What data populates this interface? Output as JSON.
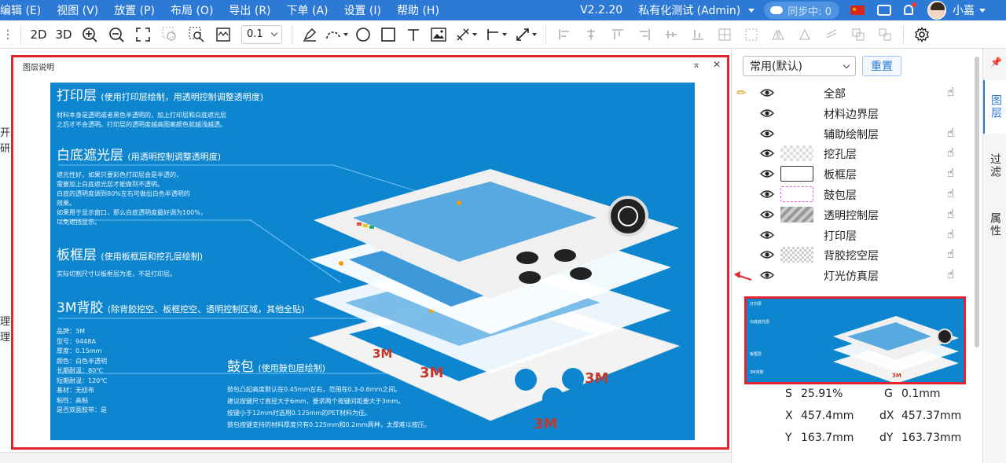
{
  "menu": {
    "items": [
      "编辑 (E)",
      "视图 (V)",
      "放置 (P)",
      "布局 (O)",
      "导出 (R)",
      "下单 (A)",
      "设置 (I)",
      "帮助 (H)"
    ],
    "version": "V2.2.20",
    "org": "私有化测试 (Admin)",
    "sync": "同步中: 0",
    "username": "小嘉"
  },
  "toolbar": {
    "btn_2d": "2D",
    "btn_3d": "3D",
    "zoom_value": "0.1"
  },
  "left_texts": [
    "开发",
    "研发",
    "",
    "",
    "",
    "",
    "",
    "",
    "",
    "",
    "",
    "",
    "",
    "理图",
    "理图"
  ],
  "dialog": {
    "title": "图层说明",
    "minimize_glyph": "⌅",
    "close_glyph": "✕",
    "sections": {
      "print": {
        "title": "打印层",
        "sub": "(使用打印层绘制，用透明控制调整透明度)",
        "body": [
          "材料本身是透明或者黑色半透明的，加上打印层和白底遮光层",
          "之后才不会透明。打印层的透明度越高图案颜色就越浅越透。"
        ]
      },
      "white": {
        "title": "白底遮光层",
        "sub": "(用透明控制调整透明度)",
        "body": [
          "遮光性好，如果只要彩色打印层会是半透的，",
          "需要加上白底遮光层才能做到不透明。",
          "白底的透明度调到80%左右可做出白色半透明的",
          "效果。",
          "如果用于显示窗口，那么白底透明度最好调为100%，",
          "以免遮挡显示。"
        ]
      },
      "frame": {
        "title": "板框层",
        "sub": "(使用板框层和挖孔层绘制)",
        "body": [
          "实际切割尺寸以板框层为准，不是打印层。"
        ]
      },
      "adhesive": {
        "title": "3M背胶",
        "sub": "(除背胶挖空、板框挖空、透明控制区域，其他全贴)",
        "body": [
          "品牌：3M",
          "型号：9448A",
          "厚度：0.15mm",
          "颜色：白色半透明",
          "长期耐温：80℃",
          "短期耐温：120℃",
          "基材：无纺布",
          "粘性：高粘",
          "是否双面胶带：是"
        ]
      },
      "bulge": {
        "title": "鼓包",
        "sub": "(使用鼓包层绘制)",
        "body": [
          "鼓包凸起高度默认在0.45mm左右，范围在0.3-0.6mm之间。",
          "建议按键尺寸直径大于6mm，要求两个按键间距要大于3mm。",
          "按键小于12mm时选用0.125mm的PET材料为佳。",
          "鼓包按键支持的材料厚度只有0.125mm和0.2mm两种，太厚难以按压。"
        ]
      }
    }
  },
  "panel": {
    "preset": "常用(默认)",
    "reset": "重置",
    "layers": [
      {
        "name": "全部",
        "swatch": "none",
        "hand": true
      },
      {
        "name": "材料边界层",
        "swatch": "none",
        "hand": false
      },
      {
        "name": "辅助绘制层",
        "swatch": "none",
        "hand": true
      },
      {
        "name": "挖孔层",
        "swatch": "check",
        "hand": true
      },
      {
        "name": "板框层",
        "swatch": "rect",
        "hand": true
      },
      {
        "name": "鼓包层",
        "swatch": "dash",
        "hand": true
      },
      {
        "name": "透明控制层",
        "swatch": "stripe",
        "hand": true
      },
      {
        "name": "打印层",
        "swatch": "none",
        "hand": true
      },
      {
        "name": "背胶挖空层",
        "swatch": "mesh",
        "hand": true
      },
      {
        "name": "灯光仿真层",
        "swatch": "none",
        "hand": true
      }
    ],
    "coords": {
      "s_label": "S",
      "s_value": "25.91%",
      "g_label": "G",
      "g_value": "0.1mm",
      "x_label": "X",
      "x_value": "457.4mm",
      "dx_label": "dX",
      "dx_value": "457.37mm",
      "y_label": "Y",
      "y_value": "163.7mm",
      "dy_label": "dY",
      "dy_value": "163.73mm"
    }
  },
  "sidetabs": [
    "图层",
    "过滤",
    "属性"
  ],
  "colors": {
    "menubar": "#2d7ad6",
    "accent": "#2d7ad6",
    "highlight_border": "#e0262c",
    "legend_bg": "#0e86cf"
  },
  "icons": [
    "cloud-icon",
    "china-flag-icon",
    "chat-icon",
    "bell-icon",
    "avatar",
    "pencil-icon",
    "eye-icon",
    "hand-icon",
    "gear-icon",
    "pin-icon"
  ]
}
